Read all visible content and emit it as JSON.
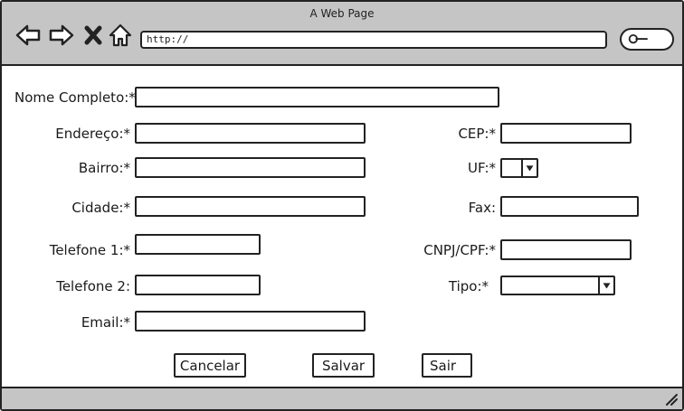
{
  "browser": {
    "title": "A Web Page",
    "url": "http://",
    "icons": {
      "back": "back-arrow-icon",
      "forward": "forward-arrow-icon",
      "stop": "close-x-icon",
      "home": "home-icon",
      "search": "search-icon",
      "resize": "resize-grip-icon"
    }
  },
  "form": {
    "nome_completo": {
      "label": "Nome Completo:*",
      "value": ""
    },
    "endereco": {
      "label": "Endereço:*",
      "value": ""
    },
    "cep": {
      "label": "CEP:*",
      "value": ""
    },
    "bairro": {
      "label": "Bairro:*",
      "value": ""
    },
    "uf": {
      "label": "UF:*",
      "value": ""
    },
    "cidade": {
      "label": "Cidade:*",
      "value": ""
    },
    "fax": {
      "label": "Fax:",
      "value": ""
    },
    "telefone1": {
      "label": "Telefone 1:*",
      "value": ""
    },
    "cnpj_cpf": {
      "label": "CNPJ/CPF:*",
      "value": ""
    },
    "telefone2": {
      "label": "Telefone 2:",
      "value": ""
    },
    "tipo": {
      "label": "Tipo:*",
      "value": ""
    },
    "email": {
      "label": "Email:*",
      "value": ""
    }
  },
  "buttons": {
    "cancel": "Cancelar",
    "save": "Salvar",
    "exit": "Sair"
  },
  "colors": {
    "chrome": "#c5c5c5",
    "stroke": "#222222",
    "background": "#ffffff"
  }
}
